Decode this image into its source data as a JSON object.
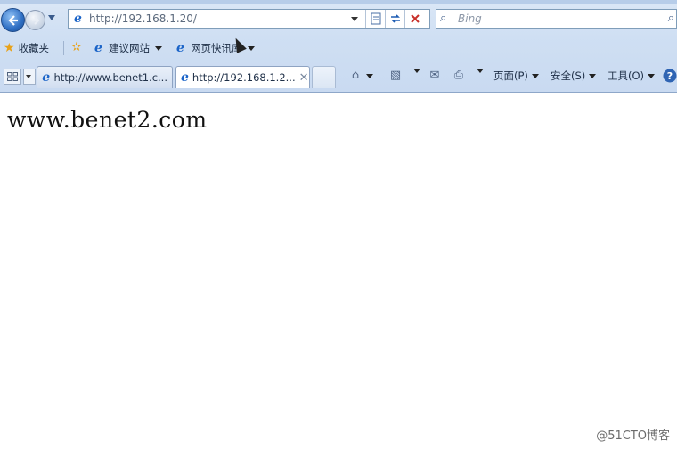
{
  "nav": {
    "address_url": "http://192.168.1.20/",
    "search_placeholder": "Bing"
  },
  "favorites_bar": {
    "favorites_label": "收藏夹",
    "items": [
      "建议网站",
      "网页快讯库"
    ]
  },
  "tabs": [
    {
      "title": "http://www.benet1.c...",
      "active": false
    },
    {
      "title": "http://192.168.1.2...",
      "active": true
    }
  ],
  "command_bar": {
    "page_label": "页面(P)",
    "safety_label": "安全(S)",
    "tools_label": "工具(O)"
  },
  "page": {
    "body_text": "www.benet2.com"
  },
  "watermark": "@51CTO博客"
}
